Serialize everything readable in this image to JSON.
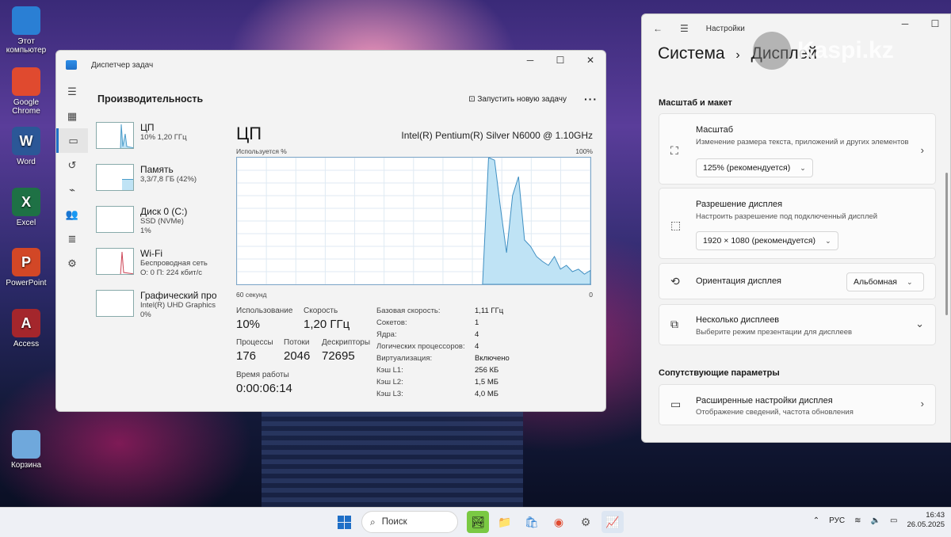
{
  "desktop": {
    "icons": [
      {
        "label": "Этот компьютер",
        "icon": "computer-icon",
        "color": "#2a7fd4"
      },
      {
        "label": "Google Chrome",
        "icon": "chrome-icon",
        "color": "#e04a2f"
      },
      {
        "label": "Word",
        "icon": "word-icon",
        "color": "#2b5797",
        "glyph": "W"
      },
      {
        "label": "Excel",
        "icon": "excel-icon",
        "color": "#1e7145",
        "glyph": "X"
      },
      {
        "label": "PowerPoint",
        "icon": "powerpoint-icon",
        "color": "#d24726",
        "glyph": "P"
      },
      {
        "label": "Access",
        "icon": "access-icon",
        "color": "#a4262c",
        "glyph": "A"
      },
      {
        "label": "Корзина",
        "icon": "recycle-bin-icon",
        "color": "#6fa8dc"
      }
    ]
  },
  "task_manager": {
    "window_title": "Диспетчер задач",
    "page_title": "Производительность",
    "run_task_label": "Запустить новую задачу",
    "resources": [
      {
        "name": "ЦП",
        "sub1": "10% 1,20 ГГц",
        "sub2": ""
      },
      {
        "name": "Память",
        "sub1": "3,3/7,8 ГБ (42%)",
        "sub2": ""
      },
      {
        "name": "Диск 0 (C:)",
        "sub1": "SSD (NVMe)",
        "sub2": "1%"
      },
      {
        "name": "Wi-Fi",
        "sub1": "Беспроводная сеть",
        "sub2": "О: 0 П: 224 кбит/с"
      },
      {
        "name": "Графический про",
        "sub1": "Intel(R) UHD Graphics",
        "sub2": "0%"
      }
    ],
    "cpu": {
      "title": "ЦП",
      "model": "Intel(R) Pentium(R) Silver N6000 @ 1.10GHz",
      "graph_label_left": "Используется %",
      "graph_label_right": "100%",
      "graph_bottom_left": "60 секунд",
      "graph_bottom_right": "0",
      "usage_series": [
        0,
        0,
        0,
        0,
        0,
        0,
        0,
        0,
        0,
        0,
        0,
        0,
        0,
        0,
        0,
        0,
        0,
        0,
        0,
        0,
        0,
        0,
        0,
        0,
        0,
        0,
        0,
        0,
        0,
        0,
        0,
        0,
        0,
        0,
        0,
        0,
        0,
        0,
        0,
        0,
        0,
        0,
        100,
        98,
        60,
        25,
        70,
        85,
        35,
        30,
        22,
        18,
        15,
        22,
        12,
        15,
        10,
        12,
        8,
        11
      ],
      "usage_label": "Использование",
      "usage_value": "10%",
      "speed_label": "Скорость",
      "speed_value": "1,20 ГГц",
      "processes_label": "Процессы",
      "processes_value": "176",
      "threads_label": "Потоки",
      "threads_value": "2046",
      "handles_label": "Дескрипторы",
      "handles_value": "72695",
      "uptime_label": "Время работы",
      "uptime_value": "0:00:06:14",
      "specs": [
        {
          "k": "Базовая скорость:",
          "v": "1,11 ГГц"
        },
        {
          "k": "Сокетов:",
          "v": "1"
        },
        {
          "k": "Ядра:",
          "v": "4"
        },
        {
          "k": "Логических процессоров:",
          "v": "4"
        },
        {
          "k": "Виртуализация:",
          "v": "Включено"
        },
        {
          "k": "Кэш L1:",
          "v": "256 КБ"
        },
        {
          "k": "Кэш L2:",
          "v": "1,5 МБ"
        },
        {
          "k": "Кэш L3:",
          "v": "4,0 МБ"
        }
      ]
    }
  },
  "settings": {
    "window_title": "Настройки",
    "breadcrumb_parent": "Система",
    "breadcrumb_sep": "›",
    "breadcrumb_current": "Дисплей",
    "watermark": "Kaspi.kz",
    "section_scale": "Масштаб и макет",
    "scale_title": "Масштаб",
    "scale_desc": "Изменение размера текста, приложений и других элементов",
    "scale_value": "125% (рекомендуется)",
    "resolution_title": "Разрешение дисплея",
    "resolution_desc": "Настроить разрешение под подключенный дисплей",
    "resolution_value": "1920 × 1080 (рекомендуется)",
    "orientation_title": "Ориентация дисплея",
    "orientation_value": "Альбомная",
    "multi_title": "Несколько дисплеев",
    "multi_desc": "Выберите режим презентации для дисплеев",
    "section_related": "Сопутствующие параметры",
    "advanced_title": "Расширенные настройки дисплея",
    "advanced_desc": "Отображение сведений, частота обновления"
  },
  "taskbar": {
    "search_placeholder": "Поиск",
    "language": "РУС",
    "time": "16:43",
    "date": "26.05.2025"
  }
}
